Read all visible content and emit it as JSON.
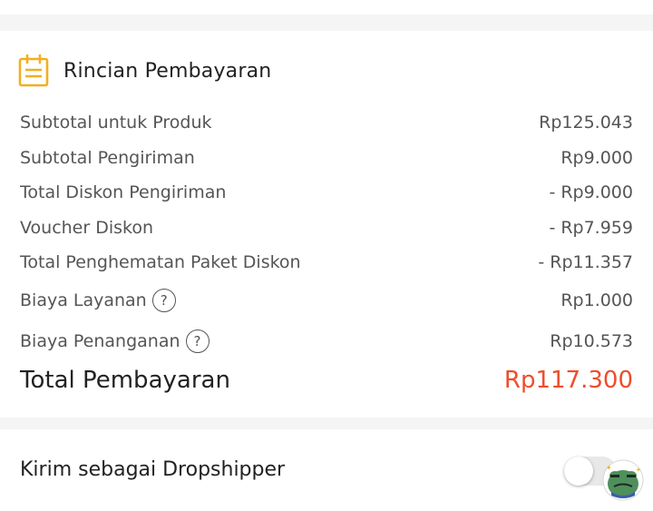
{
  "payment": {
    "icon": "receipt-list-icon",
    "title": "Rincian Pembayaran",
    "rows": [
      {
        "label": "Subtotal untuk Produk",
        "value": "Rp125.043"
      },
      {
        "label": "Subtotal Pengiriman",
        "value": "Rp9.000"
      },
      {
        "label": "Total Diskon Pengiriman",
        "value": "- Rp9.000"
      },
      {
        "label": "Voucher Diskon",
        "value": "- Rp7.959"
      },
      {
        "label": "Total Penghematan Paket Diskon",
        "value": "- Rp11.357"
      },
      {
        "label": "Biaya Layanan",
        "value": "Rp1.000",
        "help": "?"
      },
      {
        "label": "Biaya Penanganan",
        "value": "Rp10.573",
        "help": "?"
      }
    ],
    "total_label": "Total Pembayaran",
    "total_value": "Rp117.300"
  },
  "dropship": {
    "label": "Kirim sebagai Dropshipper",
    "toggle_on": false
  },
  "colors": {
    "accent": "#ee4d2d",
    "icon_yellow": "#f2b01e",
    "background": "#f5f5f5"
  }
}
